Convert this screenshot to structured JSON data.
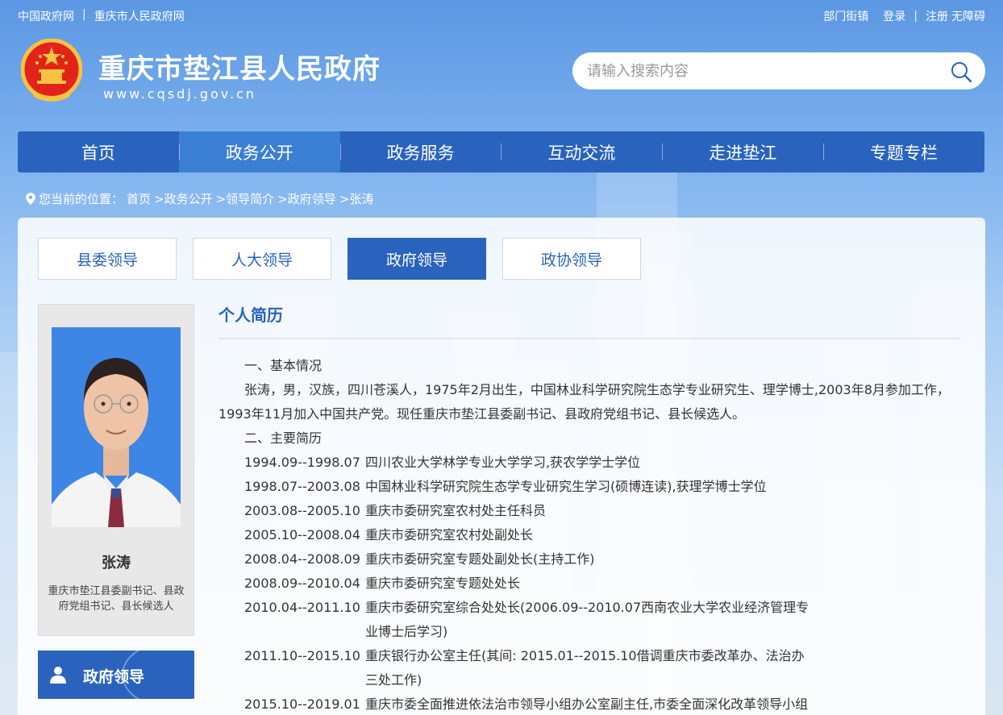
{
  "topbar": {
    "links_left": [
      "中国政府网",
      "重庆市人民政府网"
    ],
    "separator": "|",
    "links_right": [
      "部门街镇",
      "登录",
      "注册",
      "无障碍"
    ]
  },
  "header": {
    "title": "重庆市垫江县人民政府",
    "url": "www.cqsdj.gov.cn",
    "search_placeholder": "请输入搜索内容"
  },
  "nav": {
    "items": [
      "首页",
      "政务公开",
      "政务服务",
      "互动交流",
      "走进垫江",
      "专题专栏"
    ],
    "active_index": 1
  },
  "breadcrumb": {
    "prefix": "您当前的位置：",
    "items": [
      "首页",
      ">政务公开",
      ">领导简介",
      ">政府领导",
      ">张涛"
    ]
  },
  "tabs": {
    "items": [
      "县委领导",
      "人大领导",
      "政府领导",
      "政协领导"
    ],
    "active_index": 2
  },
  "profile": {
    "name": "张涛",
    "title": "重庆市垫江县委副书记、县政府党组书记、县长候选人"
  },
  "side_nav": {
    "label": "政府领导"
  },
  "bio": {
    "section_title": "个人简历",
    "basic_heading": "一、基本情况",
    "basic_text": "张涛，男，汉族，四川苍溪人，1975年2月出生，中国林业科学研究院生态学专业研究生、理学博士,2003年8月参加工作，1993年11月加入中国共产党。现任重庆市垫江县委副书记、县政府党组书记、县长候选人。",
    "career_heading": "二、主要简历",
    "career": [
      {
        "period": "1994.09--1998.07",
        "desc": "四川农业大学林学专业大学学习,获农学学士学位"
      },
      {
        "period": "1998.07--2003.08",
        "desc": "中国林业科学研究院生态学专业研究生学习(硕博连读),获理学博士学位"
      },
      {
        "period": "2003.08--2005.10",
        "desc": "重庆市委研究室农村处主任科员"
      },
      {
        "period": "2005.10--2008.04",
        "desc": "重庆市委研究室农村处副处长"
      },
      {
        "period": "2008.04--2008.09",
        "desc": "重庆市委研究室专题处副处长(主持工作)"
      },
      {
        "period": "2008.09--2010.04",
        "desc": "重庆市委研究室专题处处长"
      },
      {
        "period": "2010.04--2011.10",
        "desc": "重庆市委研究室综合处处长(2006.09--2010.07西南农业大学农业经济管理专业博士后学习)"
      },
      {
        "period": "2011.10--2015.10",
        "desc": "重庆银行办公室主任(其间: 2015.01--2015.10借调重庆市委改革办、法治办三处工作)"
      },
      {
        "period": "2015.10--2019.01",
        "desc": "重庆市委全面推进依法治市领导小组办公室副主任,市委全面深化改革领导小组办"
      }
    ]
  },
  "colors": {
    "primary": "#2a63be",
    "nav_active": "#3b7fd4",
    "photo_bg": "#3e86e6"
  }
}
